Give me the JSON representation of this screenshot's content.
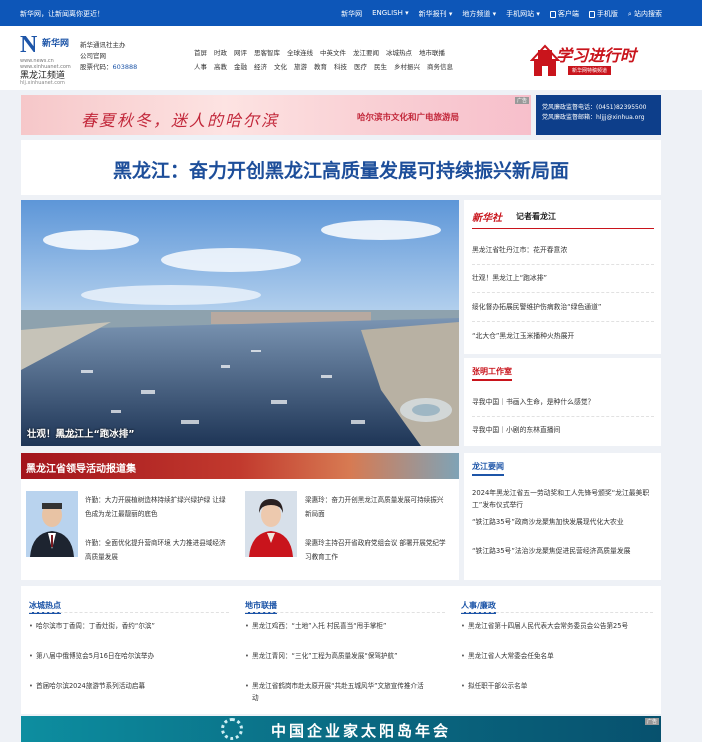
{
  "topbar": {
    "slogan": "新华网，让新闻离你更近！",
    "links": [
      "新华网",
      "ENGLISH ▾",
      "新华报刊 ▾",
      "地方频道 ▾",
      "手机网站 ▾",
      "客户端",
      "手机版",
      "站内搜索"
    ]
  },
  "logo": {
    "mark": "N",
    "brand": "新华网",
    "url": "www.news.cn  www.xinhuanet.com",
    "channel": "黑龙江频道",
    "channel_url": "hlj.xinhuanet.com"
  },
  "intro": {
    "line1": "新华通讯社主办",
    "line2": "公司官网",
    "code_label": "股票代码：",
    "code": "603888"
  },
  "nav": {
    "row1": [
      "首屏",
      "时政",
      "网评",
      "思客智库",
      "全球连线",
      "中英文件",
      "龙江要闻",
      "冰城热点",
      "地市联播"
    ],
    "row2": [
      "人事",
      "高教",
      "金融",
      "经济",
      "文化",
      "旅游",
      "教育",
      "科技",
      "医疗",
      "民生",
      "乡村振兴",
      "商务信息"
    ]
  },
  "promo": {
    "title": "学习进行时",
    "subtitle": "新华网特稿频道"
  },
  "ads": {
    "tag": "广告",
    "banner1_slogan": "春夏秋冬，迷人的哈尔滨",
    "banner1_org": "哈尔滨市文化和广电旅游局",
    "banner2_line1": "党风廉政监督电话：(0451)82395500",
    "banner2_line2": "党风廉政监督邮箱：hljjj@xinhua.org",
    "bottom_banner": "中国企业家太阳岛年会"
  },
  "headline": "黑龙江：奋力开创黑龙江高质量发展可持续振兴新局面",
  "hero": {
    "caption": "壮观！黑龙江上“跑冰排”"
  },
  "reporter": {
    "brand": "新华社",
    "title": "记者看龙江",
    "items": [
      "黑龙江省牡丹江市：花开春意浓",
      "壮观！黑龙江上“跑冰排”",
      "绥化督办拓展民警维护伤病救治“绿色通道”",
      "“北大仓”黑龙江玉米播种火热展开"
    ]
  },
  "zhang": {
    "title": "张明工作室",
    "items": [
      "寻我中国｜书画入生命，是种什么感觉？",
      "寻我中国｜小剧的东林直播间"
    ]
  },
  "leaders": {
    "title": "黑龙江省领导活动报道集",
    "left": [
      "许勤：大力开展植树造林持续扩绿兴绿护绿 让绿色成为龙江最靓丽的底色",
      "许勤：全面优化提升营商环境 大力推进县域经济高质量发展"
    ],
    "right": [
      "梁惠玲：奋力开创黑龙江高质量发展可持续振兴新局面",
      "梁惠玲主持召开省政府党组会议 部署开展党纪学习教育工作"
    ]
  },
  "longjiang": {
    "title": "龙江要闻",
    "items": [
      "2024年黑龙江省五一劳动奖和工人先锋号颁奖“龙江最美职工”发布仪式举行",
      "“铁江路35号”政商沙龙聚焦加快发展现代化大农业",
      "“铁江路35号”法治沙龙聚焦促进民营经济高质量发展"
    ]
  },
  "columns": [
    {
      "title": "冰城热点",
      "items": [
        "哈尔滨市丁香周：丁香灶街，香约“尔滨”",
        "第八届中俄博览会5月16日在哈尔滨举办",
        "首届哈尔滨2024旅游节系列活动启幕"
      ]
    },
    {
      "title": "地市联播",
      "items": [
        "黑龙江鸡西：“土地”入托 村民喜当“甩手掌柜”",
        "黑龙江青冈：“三化”工程为高质量发展“保驾护航”",
        "黑龙江省鹤岗市赴太原开展“共赴五城风华”文旅宣传推介活动"
      ]
    },
    {
      "title": "人事/廉政",
      "items": [
        "黑龙江省第十四届人民代表大会常务委员会公告第25号",
        "黑龙江省人大常委会任免名单",
        "拟任职干部公示名单"
      ]
    }
  ]
}
